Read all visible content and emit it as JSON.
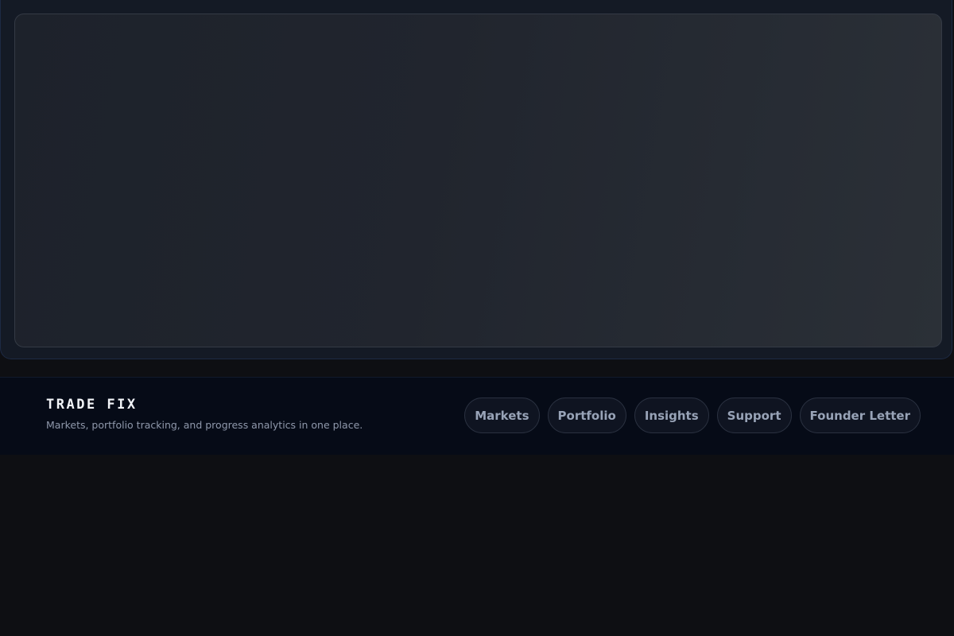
{
  "brand": {
    "name": "TRADE FIX",
    "tagline": "Markets, portfolio tracking, and progress analytics in one place."
  },
  "nav": {
    "items": [
      {
        "label": "Markets"
      },
      {
        "label": "Portfolio"
      },
      {
        "label": "Insights"
      },
      {
        "label": "Support"
      },
      {
        "label": "Founder Letter"
      }
    ]
  },
  "colors": {
    "page_background": "#0e0f13",
    "header_background": "#060b17",
    "brand_text": "#f2f4f8",
    "nav_text": "#98a3b7",
    "hero_panel": "#21252e"
  }
}
